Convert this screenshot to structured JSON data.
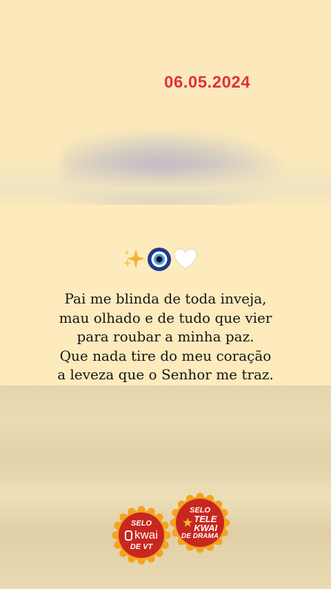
{
  "post": {
    "date": "06.05.2024",
    "emoji": [
      "sparkles",
      "nazar-amulet",
      "white-heart"
    ],
    "quote_lines": [
      "Pai me blinda de toda inveja,",
      "mau olhado e de tudo que vier",
      "para roubar a minha paz.",
      "Que nada tire do meu coração",
      "a leveza que o Senhor me traz."
    ]
  },
  "badges": {
    "vt": {
      "top": "SELO",
      "brand": "kwai",
      "bottom": "DE VT"
    },
    "drama": {
      "top": "SELO",
      "brand_line1": "TELE",
      "brand_line2": "KWAI",
      "bottom": "DE DRAMA"
    }
  },
  "colors": {
    "date": "#e2303e",
    "background": "#fbe9bd",
    "badge_red": "#c8271f",
    "badge_ring": "#f4a320"
  }
}
